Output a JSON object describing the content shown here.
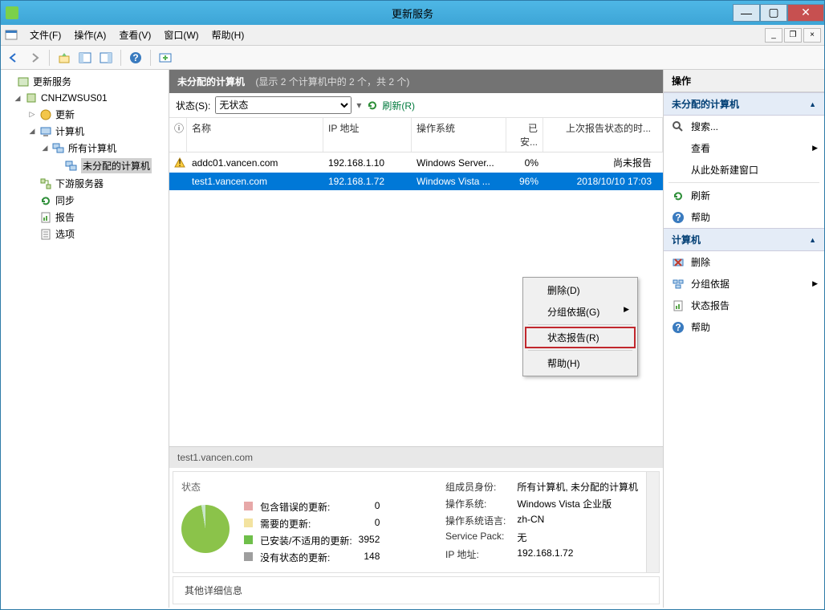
{
  "window": {
    "title": "更新服务"
  },
  "menubar": {
    "file": "文件(F)",
    "action": "操作(A)",
    "view": "查看(V)",
    "window": "窗口(W)",
    "help": "帮助(H)"
  },
  "tree": {
    "root": "更新服务",
    "server": "CNHZWSUS01",
    "updates": "更新",
    "computers": "计算机",
    "all_computers": "所有计算机",
    "unassigned": "未分配的计算机",
    "downstream": "下游服务器",
    "sync": "同步",
    "reports": "报告",
    "options": "选项"
  },
  "center": {
    "title": "未分配的计算机",
    "subtitle": "(显示 2 个计算机中的 2 个，共 2 个)",
    "status_label": "状态(S):",
    "status_value": "无状态",
    "refresh": "刷新(R)",
    "columns": {
      "name": "名称",
      "ip": "IP 地址",
      "os": "操作系统",
      "inst": "已安...",
      "last": "上次报告状态的时..."
    },
    "rows": [
      {
        "warn": true,
        "name": "addc01.vancen.com",
        "ip": "192.168.1.10",
        "os": "Windows Server...",
        "inst": "0%",
        "last": "尚未报告"
      },
      {
        "sel": true,
        "name": "test1.vancen.com",
        "ip": "192.168.1.72",
        "os": "Windows Vista ...",
        "inst": "96%",
        "last": "2018/10/10 17:03"
      }
    ]
  },
  "context_menu": {
    "delete": "删除(D)",
    "group_by": "分组依据(G)",
    "status_report": "状态报告(R)",
    "help": "帮助(H)"
  },
  "detail": {
    "host": "test1.vancen.com",
    "status_title": "状态",
    "legend": {
      "errors": "包含错误的更新:",
      "errors_v": "0",
      "needed": "需要的更新:",
      "needed_v": "0",
      "installed_na": "已安装/不适用的更新:",
      "installed_na_v": "3952",
      "none": "没有状态的更新:",
      "none_v": "148"
    },
    "kv": {
      "membership_k": "组成员身份:",
      "membership_v": "所有计算机, 未分配的计算机",
      "os_k": "操作系统:",
      "os_v": "Windows Vista 企业版",
      "oslang_k": "操作系统语言:",
      "oslang_v": "zh-CN",
      "sp_k": "Service Pack:",
      "sp_v": "无",
      "ip_k": "IP 地址:",
      "ip_v": "192.168.1.72"
    },
    "other": "其他详细信息"
  },
  "actions": {
    "pane_title": "操作",
    "group1_title": "未分配的计算机",
    "search": "搜索...",
    "view": "查看",
    "new_window": "从此处新建窗口",
    "refresh": "刷新",
    "help": "帮助",
    "group2_title": "计算机",
    "delete": "删除",
    "group_by": "分组依据",
    "status_report": "状态报告",
    "help2": "帮助"
  }
}
